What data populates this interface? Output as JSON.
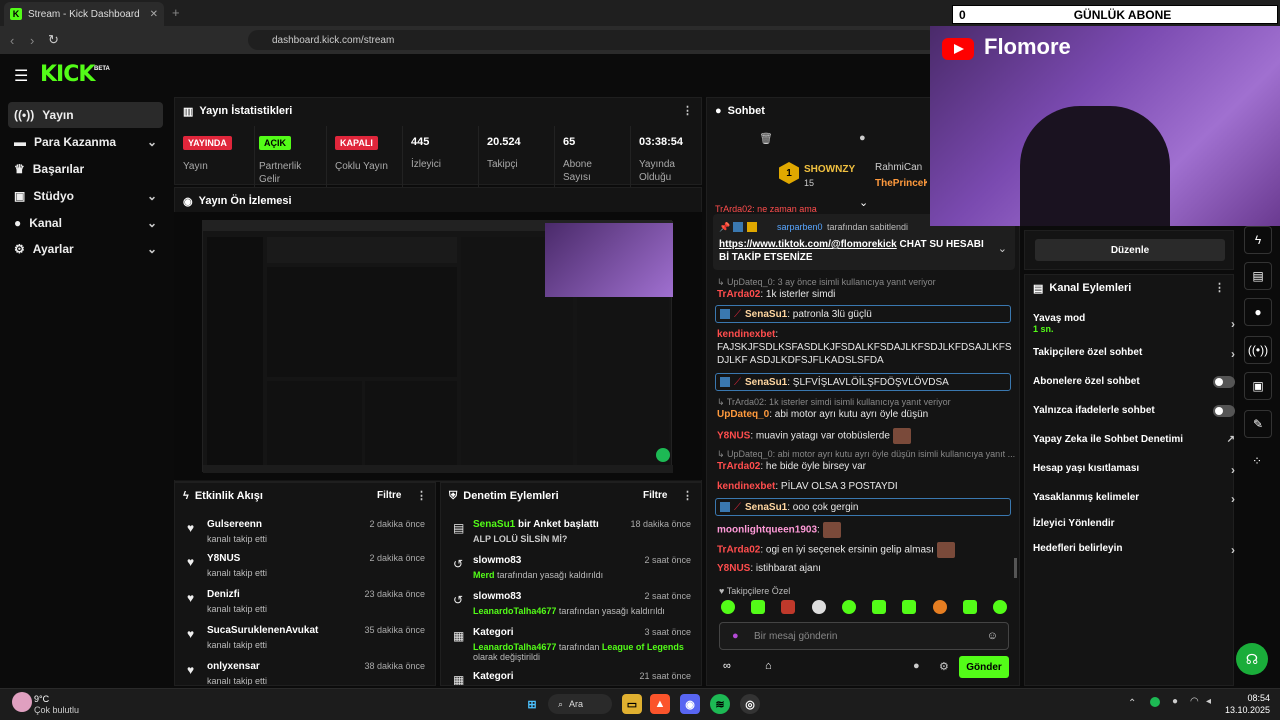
{
  "browser": {
    "tab_title": "Stream - Kick Dashboard",
    "url": "dashboard.kick.com/stream"
  },
  "brand": {
    "logo": "KICK",
    "beta": "BETA"
  },
  "sidebar": {
    "items": [
      {
        "label": "Yayın",
        "icon": "broadcast-icon"
      },
      {
        "label": "Para Kazanma",
        "icon": "money-icon"
      },
      {
        "label": "Başarılar",
        "icon": "trophy-icon"
      },
      {
        "label": "Stüdyo",
        "icon": "studio-icon"
      },
      {
        "label": "Kanal",
        "icon": "person-icon"
      },
      {
        "label": "Ayarlar",
        "icon": "gear-icon"
      }
    ]
  },
  "stats": {
    "title": "Yayın İstatistikleri",
    "items": [
      {
        "badge": "YAYINDA",
        "label": "Yayın"
      },
      {
        "badge": "AÇIK",
        "label": "Partnerlik Gelir"
      },
      {
        "badge": "KAPALI",
        "label": "Çoklu Yayın"
      },
      {
        "value": "445",
        "label": "İzleyici"
      },
      {
        "value": "20.524",
        "label": "Takipçi"
      },
      {
        "value": "65",
        "label": "Abone Sayısı"
      },
      {
        "value": "03:38:54",
        "label": "Yayında Olduğu"
      }
    ]
  },
  "preview": {
    "title": "Yayın Ön İzlemesi"
  },
  "activity": {
    "title": "Etkinlik Akışı",
    "filter": "Filtre",
    "rows": [
      {
        "name": "Gulsereenn",
        "sub": "kanalı takip etti",
        "time": "2 dakika önce"
      },
      {
        "name": "Y8NUS",
        "sub": "kanalı takip etti",
        "time": "2 dakika önce"
      },
      {
        "name": "Denizfi",
        "sub": "kanalı takip etti",
        "time": "23 dakika önce"
      },
      {
        "name": "SucaSuruklenenAvukat",
        "sub": "kanalı takip etti",
        "time": "35 dakika önce"
      },
      {
        "name": "onlyxensar",
        "sub": "kanalı takip etti",
        "time": "38 dakika önce"
      }
    ]
  },
  "moderation": {
    "title": "Denetim Eylemleri",
    "filter": "Filtre",
    "rows": [
      {
        "name": "SenaSu1",
        "name_rest": " bir Anket başlattı",
        "sub": "ALP LOLÜ SİLSİN Mİ?",
        "time": "18 dakika önce"
      },
      {
        "name": "slowmo83",
        "sub_user": "Merd",
        "sub": " tarafından yasağı kaldırıldı",
        "time": "2 saat önce"
      },
      {
        "name": "slowmo83",
        "sub_user": "LeanardoTalha4677",
        "sub": " tarafından yasağı kaldırıldı",
        "time": "2 saat önce"
      },
      {
        "name": "Kategori",
        "sub_user": "LeanardoTalha4677",
        "sub": " tarafından ",
        "sub_link": "League of Legends",
        "sub2": "olarak değiştirildi",
        "time": "3 saat önce"
      },
      {
        "name": "Kategori",
        "time": "21 saat önce"
      }
    ]
  },
  "chat": {
    "title": "Sohbet",
    "top_users": [
      {
        "name": "SHOWNZY",
        "count": "15"
      },
      {
        "name": "RahmiCan"
      },
      {
        "name": "ThePrinceK"
      }
    ],
    "pinned": {
      "by": "sarparben0",
      "by_suffix": " tarafından sabitlendi",
      "link": "https://www.tiktok.com/@flomorekick",
      "text": " CHAT SU HESABI Bİ TAKİP ETSENİZE"
    },
    "partial_top": "TrArda02: ne zaman ama",
    "messages": [
      {
        "reply": "↳ UpDateq_0: 3 ay önce isimli kullanıcıya yanıt veriyor"
      },
      {
        "user": "TrArda02",
        "color": "#ff4d4d",
        "text": ": 1k isterler simdi"
      },
      {
        "user": "SenaSu1",
        "color": "#ffd6a0",
        "text": ": patronla 3lü güçlü",
        "highlight": true
      },
      {
        "user": "kendinexbet",
        "color": "#ff4d4d",
        "text": ":"
      },
      {
        "text": "FAJSKJFSDLKSFASDLKJFSDALKFSDAJLKFSDJLKFDSAJLKFSDJLKF ASDJLKDFSJFLKADSLSFDA"
      },
      {
        "user": "SenaSu1",
        "color": "#ffd6a0",
        "text": ": ŞLFVİŞLAVLÖİLŞFDÖŞVLÖVDSA",
        "highlight": true
      },
      {
        "reply": "↳ TrArda02: 1k isterler simdi isimli kullanıcıya yanıt veriyor"
      },
      {
        "user": "UpDateq_0",
        "color": "#ff9a3d",
        "text": ": abi motor ayrı kutu ayrı öyle düşün"
      },
      {
        "user": "Y8NUS",
        "color": "#ff4d4d",
        "text": ": muavin yatagı var otobüslerde"
      },
      {
        "reply": "↳ UpDateq_0: abi motor ayrı kutu ayrı öyle düşün isimli kullanıcıya yanıt ..."
      },
      {
        "user": "TrArda02",
        "color": "#ff4d4d",
        "text": ": he bide öyle birsey var"
      },
      {
        "user": "kendinexbet",
        "color": "#ff4d4d",
        "text": ": PİLAV OLSA 3 POSTAYDI"
      },
      {
        "user": "SenaSu1",
        "color": "#ffd6a0",
        "text": ": ooo çok gergin",
        "highlight": true
      },
      {
        "user": "moonlightqueen1903",
        "color": "#ff9ad8",
        "text": ":"
      },
      {
        "user": "TrArda02",
        "color": "#ff4d4d",
        "text": ": ogi en iyi seçenek ersinin gelip alması"
      },
      {
        "user": "Y8NUS",
        "color": "#ff4d4d",
        "text": ": istihbarat ajanı"
      }
    ],
    "followers_only": "Takipçilere Özel",
    "input_placeholder": "Bir mesaj gönderin",
    "send": "Gönder"
  },
  "right": {
    "edit_button": "Düzenle",
    "channel_actions_title": "Kanal Eylemleri",
    "slow_mode": "Yavaş mod",
    "slow_mode_value": "1 sn.",
    "rows": [
      {
        "label": "Takipçilere özel sohbet",
        "control": "chevron"
      },
      {
        "label": "Abonelere özel sohbet",
        "control": "toggle"
      },
      {
        "label": "Yalnızca ifadelerle sohbet",
        "control": "toggle"
      },
      {
        "label": "Yapay Zeka ile Sohbet Denetimi",
        "control": "external"
      },
      {
        "label": "Hesap yaşı kısıtlaması",
        "control": "chevron"
      },
      {
        "label": "Yasaklanmış kelimeler",
        "control": "chevron"
      },
      {
        "label": "İzleyici Yönlendir",
        "control": "none"
      },
      {
        "label": "Hedefleri belirleyin",
        "control": "chevron"
      }
    ]
  },
  "overlay": {
    "abone_count": "0",
    "abone_label": "GÜNLÜK ABONE",
    "youtube_name": "Flomore"
  },
  "taskbar": {
    "weather_temp": "9°C",
    "weather_desc": "Çok bulutlu",
    "search": "Ara",
    "time": "08:54",
    "date": "13.10.2025"
  }
}
